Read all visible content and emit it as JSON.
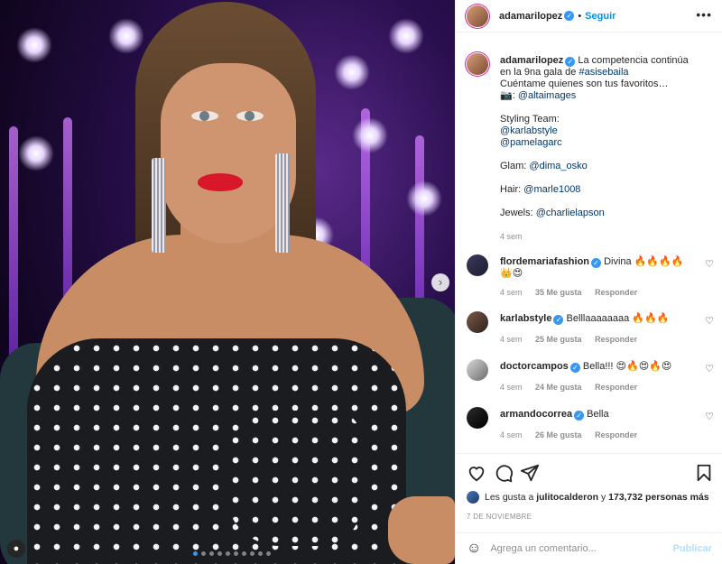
{
  "header": {
    "username": "adamarilopez",
    "follow_label": "Seguir",
    "more_icon": "more-horizontal-icon"
  },
  "caption": {
    "username": "adamarilopez",
    "text_before_hashtag": "La competencia continúa en la 9na gala de",
    "hashtag": "#asisebaila",
    "line2": "Cuéntame quienes son tus favoritos…",
    "photo_credit_prefix": ": ",
    "photo_credit": "@altaimages",
    "styling_label": "Styling Team:",
    "styling_1": "@karlabstyle",
    "styling_2": "@pamelagarc",
    "glam_label": "Glam: ",
    "glam": "@dima_osko",
    "hair_label": "Hair: ",
    "hair": "@marle1008",
    "jewels_label": "Jewels: ",
    "jewels": "@charlielapson",
    "time": "4 sem"
  },
  "comments": [
    {
      "username": "flordemariafashion",
      "text": "Divina 🔥🔥🔥🔥👑😍",
      "time": "4 sem",
      "likes": "35 Me gusta",
      "reply": "Responder"
    },
    {
      "username": "karlabstyle",
      "text": "Belllaaaaaaaa 🔥🔥🔥",
      "time": "4 sem",
      "likes": "25 Me gusta",
      "reply": "Responder"
    },
    {
      "username": "doctorcampos",
      "text": "Bella!!! 😍🔥😍🔥😍",
      "time": "4 sem",
      "likes": "24 Me gusta",
      "reply": "Responder"
    },
    {
      "username": "armandocorrea",
      "text": "Bella",
      "time": "4 sem",
      "likes": "26 Me gusta",
      "reply": "Responder"
    }
  ],
  "likes": {
    "prefix": "Les gusta a ",
    "first_user": "julitocalderon",
    "middle": " y ",
    "count": "173,732 personas más"
  },
  "date": "7 DE NOVIEMBRE",
  "add_comment": {
    "placeholder": "Agrega un comentario...",
    "post_label": "Publicar"
  },
  "carousel": {
    "total": 10,
    "active_index": 0
  },
  "colors": {
    "accent": "#0095f6",
    "verified": "#3897f0",
    "muted": "#8e8e8e",
    "lips": "#d8172b"
  }
}
